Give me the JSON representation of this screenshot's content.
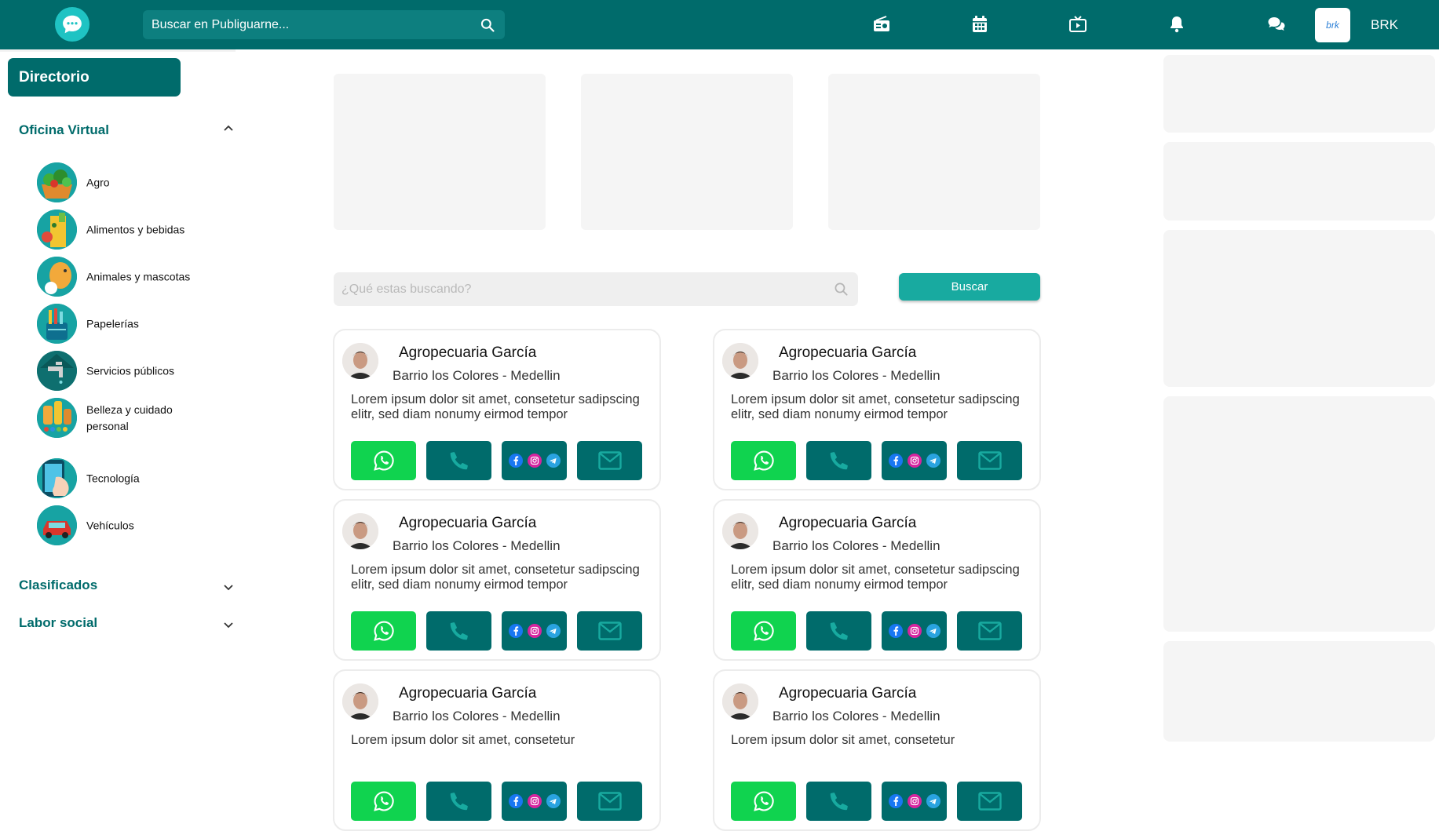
{
  "header": {
    "search_placeholder": "Buscar en Publiguarne...",
    "icons": [
      "radio-icon",
      "calendar-icon",
      "tv-icon",
      "bell-icon",
      "chat-icon"
    ],
    "brand_label": "brk",
    "username": "BRK"
  },
  "sidebar": {
    "directory_label": "Directorio",
    "sections": [
      {
        "title": "Oficina Virtual",
        "expanded": true
      },
      {
        "title": "Clasificados",
        "expanded": false
      },
      {
        "title": "Labor social",
        "expanded": false
      }
    ],
    "categories": [
      {
        "label": "Agro",
        "icon": "agro-icon"
      },
      {
        "label": "Alimentos y bebidas",
        "icon": "food-drinks-icon"
      },
      {
        "label": "Animales y mascotas",
        "icon": "pets-icon"
      },
      {
        "label": "Papelerías",
        "icon": "stationery-icon"
      },
      {
        "label": "Servicios públicos",
        "icon": "public-services-icon"
      },
      {
        "label": "Belleza y cuidado personal",
        "icon": "beauty-icon"
      },
      {
        "label": "Tecnología",
        "icon": "technology-icon"
      },
      {
        "label": "Vehículos",
        "icon": "vehicles-icon"
      }
    ]
  },
  "main": {
    "search_placeholder": "¿Qué estas buscando?",
    "search_button": "Buscar",
    "cards": [
      {
        "name": "Agropecuaria García",
        "location": "Barrio los Colores - Medellin",
        "description": "Lorem ipsum dolor sit amet, consetetur sadipscing elitr, sed diam nonumy eirmod tempor"
      },
      {
        "name": "Agropecuaria García",
        "location": "Barrio los Colores - Medellin",
        "description": "Lorem ipsum dolor sit amet, consetetur sadipscing elitr, sed diam nonumy eirmod tempor"
      },
      {
        "name": "Agropecuaria García",
        "location": "Barrio los Colores - Medellin",
        "description": "Lorem ipsum dolor sit amet, consetetur sadipscing elitr, sed diam nonumy eirmod tempor"
      },
      {
        "name": "Agropecuaria García",
        "location": "Barrio los Colores - Medellin",
        "description": "Lorem ipsum dolor sit amet, consetetur sadipscing elitr, sed diam nonumy eirmod tempor"
      },
      {
        "name": "Agropecuaria García",
        "location": "Barrio los Colores - Medellin",
        "description": "Lorem ipsum dolor sit amet, consetetur"
      },
      {
        "name": "Agropecuaria García",
        "location": "Barrio los Colores - Medellin",
        "description": "Lorem ipsum dolor sit amet, consetetur"
      }
    ]
  },
  "colors": {
    "primary": "#006b6b",
    "accent": "#18aaa0",
    "whatsapp": "#10d34f",
    "placeholder_bg": "#f5f5f5"
  }
}
